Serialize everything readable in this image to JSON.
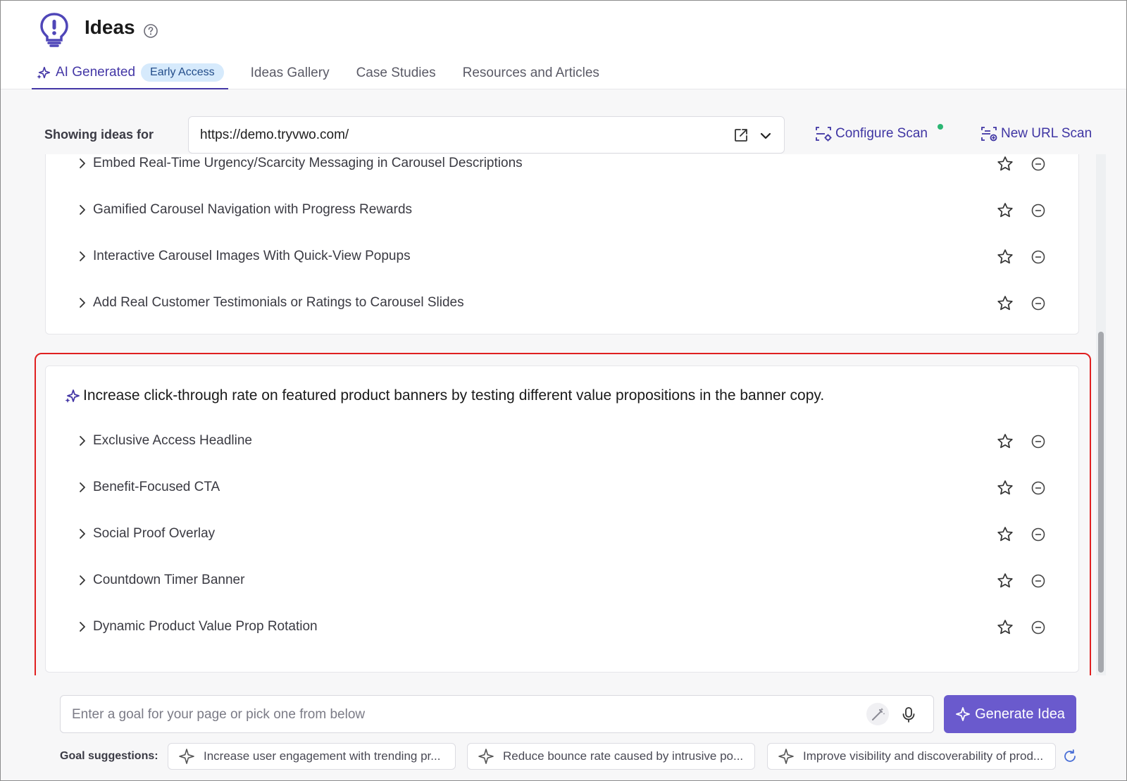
{
  "header": {
    "title": "Ideas",
    "tabs": [
      {
        "label": "AI Generated",
        "badge": "Early Access",
        "active": true
      },
      {
        "label": "Ideas Gallery"
      },
      {
        "label": "Case Studies"
      },
      {
        "label": "Resources and Articles"
      }
    ]
  },
  "scan": {
    "showing_label": "Showing ideas for",
    "url": "https://demo.tryvwo.com/",
    "configure_label": "Configure Scan",
    "new_scan_label": "New URL Scan"
  },
  "groups": [
    {
      "goal": "",
      "ideas": [
        "Embed Real-Time Urgency/Scarcity Messaging in Carousel Descriptions",
        "Gamified Carousel Navigation with Progress Rewards",
        "Interactive Carousel Images With Quick-View Popups",
        "Add Real Customer Testimonials or Ratings to Carousel Slides"
      ]
    },
    {
      "goal": "Increase click-through rate on featured product banners by testing different value propositions in the banner copy.",
      "ideas": [
        "Exclusive Access Headline",
        "Benefit-Focused CTA",
        "Social Proof Overlay",
        "Countdown Timer Banner",
        "Dynamic Product Value Prop Rotation"
      ]
    }
  ],
  "prompt": {
    "placeholder": "Enter a goal for your page or pick one from below",
    "generate_label": "Generate Idea"
  },
  "suggestions": {
    "label": "Goal suggestions:",
    "items": [
      "Increase user engagement with trending pr...",
      "Reduce bounce rate caused by intrusive po...",
      "Improve visibility and discoverability of prod..."
    ]
  },
  "colors": {
    "accent": "#4437a6",
    "button": "#6a5acd",
    "highlight": "#e02020",
    "status_dot": "#2bb673"
  }
}
